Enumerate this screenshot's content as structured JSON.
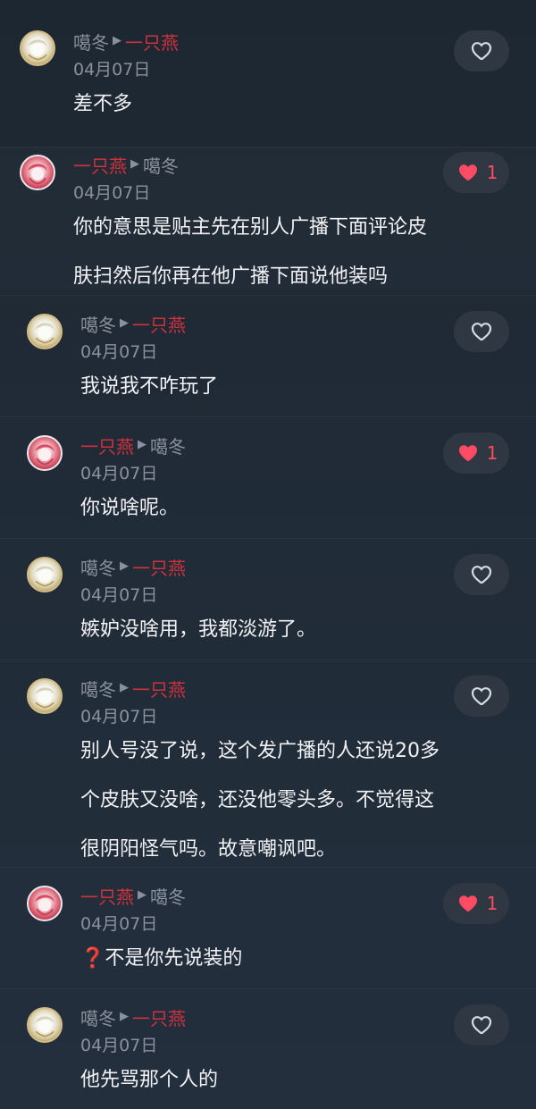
{
  "comments": [
    {
      "author": "噶冬",
      "reply_to": "一只燕",
      "date": "04月07日",
      "lines": [
        "差不多"
      ],
      "liked": false,
      "like_count": "",
      "author_style": "gray",
      "reply_style": "red"
    },
    {
      "author": "一只燕",
      "reply_to": "噶冬",
      "date": "04月07日",
      "lines": [
        "你的意思是贴主先在别人广播下面评论皮",
        "肤扫然后你再在他广播下面说他装吗"
      ],
      "liked": true,
      "like_count": "1",
      "author_style": "red",
      "reply_style": "gray"
    },
    {
      "author": "噶冬",
      "reply_to": "一只燕",
      "date": "04月07日",
      "lines": [
        "我说我不咋玩了"
      ],
      "liked": false,
      "like_count": "",
      "author_style": "gray",
      "reply_style": "red"
    },
    {
      "author": "一只燕",
      "reply_to": "噶冬",
      "date": "04月07日",
      "lines": [
        "你说啥呢。"
      ],
      "liked": true,
      "like_count": "1",
      "author_style": "red",
      "reply_style": "gray"
    },
    {
      "author": "噶冬",
      "reply_to": "一只燕",
      "date": "04月07日",
      "lines": [
        "嫉妒没啥用，我都淡游了。"
      ],
      "liked": false,
      "like_count": "",
      "author_style": "gray",
      "reply_style": "red"
    },
    {
      "author": "噶冬",
      "reply_to": "一只燕",
      "date": "04月07日",
      "lines": [
        "别人号没了说，这个发广播的人还说20多",
        "个皮肤又没啥，还没他零头多。不觉得这",
        "很阴阳怪气吗。故意嘲讽吧。"
      ],
      "liked": false,
      "like_count": "",
      "author_style": "gray",
      "reply_style": "red"
    },
    {
      "author": "一只燕",
      "reply_to": "噶冬",
      "date": "04月07日",
      "lines": [
        "❓不是你先说装的"
      ],
      "liked": true,
      "like_count": "1",
      "author_style": "red",
      "reply_style": "gray"
    },
    {
      "author": "噶冬",
      "reply_to": "一只燕",
      "date": "04月07日",
      "lines": [
        "他先骂那个人的"
      ],
      "liked": false,
      "like_count": "",
      "author_style": "gray",
      "reply_style": "red"
    }
  ],
  "icons": {
    "like_empty": "heart-outline-icon",
    "like_filled": "heart-filled-icon",
    "reply_arrow": "caret-right-icon",
    "question": "red-question-mark-icon"
  },
  "colors": {
    "background_top": "#1d2731",
    "background_bottom": "#232f3d",
    "text_primary": "#f2f2f4",
    "text_secondary": "#8a919c",
    "name_red": "#d1303d",
    "like_active": "#ff4b63",
    "like_button_bg": "#2f3742"
  }
}
